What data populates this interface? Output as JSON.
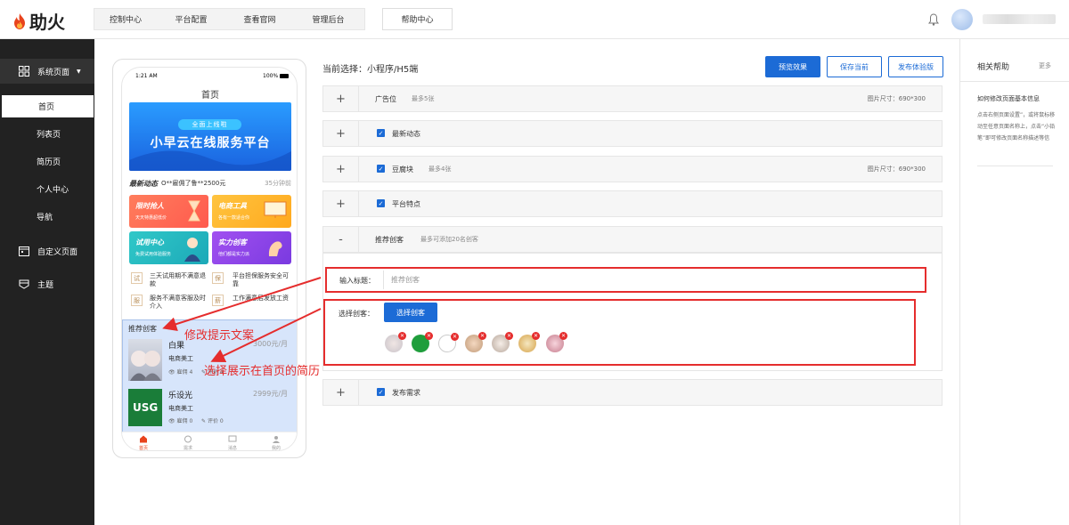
{
  "header": {
    "logo_text": "助火",
    "nav": [
      "控制中心",
      "平台配置",
      "查看官网",
      "管理后台"
    ],
    "help": "帮助中心"
  },
  "sidebar": {
    "system_pages": "系统页面",
    "sub_items": [
      "首页",
      "列表页",
      "简历页",
      "个人中心",
      "导航"
    ],
    "custom_pages": "自定义页面",
    "theme": "主题"
  },
  "phone": {
    "time": "1:21 AM",
    "battery": "100%",
    "title": "首页",
    "banner_pill": "全面上线啦",
    "banner_main": "小早云在线服务平台",
    "news_label": "最新动态",
    "news_text": "O**雇佣了鲁**2500元",
    "news_time": "35分钟前",
    "tiles": [
      {
        "title": "限时抢人",
        "sub": "天天特惠超低价"
      },
      {
        "title": "电商工具",
        "sub": "各有一款适合你"
      },
      {
        "title": "试用中心",
        "sub": "免费试用体验服务"
      },
      {
        "title": "实力创客",
        "sub": "他们都是实力派"
      }
    ],
    "features": [
      {
        "icon": "试",
        "text": "三天试用期不满意退款"
      },
      {
        "icon": "保",
        "text": "平台担保服务安全可靠"
      },
      {
        "icon": "服",
        "text": "服务不满意客服及时介入"
      },
      {
        "icon": "薪",
        "text": "工作满意后发放工资"
      }
    ],
    "rec_title": "推荐创客",
    "rec_items": [
      {
        "name": "白果",
        "price": "3000元/月",
        "role": "电商美工",
        "hire": "雇佣 4",
        "review": "评价 4"
      },
      {
        "name": "乐设光",
        "price": "2999元/月",
        "role": "电商美工",
        "hire": "雇佣 0",
        "review": "评价 0"
      }
    ],
    "tabs": [
      "首页",
      "需求",
      "消息",
      "我的"
    ]
  },
  "main": {
    "current_selection": "当前选择：小程序/H5端",
    "preview_btn": "预览效果",
    "save_btn": "保存当前",
    "publish_btn": "发布体验版",
    "panels": [
      {
        "title": "广告位",
        "hint": "最多5张",
        "size": "图片尺寸：690*300"
      },
      {
        "title": "最新动态",
        "hint": "",
        "size": ""
      },
      {
        "title": "豆腐块",
        "hint": "最多4张",
        "size": "图片尺寸：690*300"
      },
      {
        "title": "平台特点",
        "hint": "",
        "size": ""
      },
      {
        "title": "推荐创客",
        "hint": "最多可添加20名创客",
        "size": ""
      },
      {
        "title": "发布需求",
        "hint": "",
        "size": ""
      }
    ],
    "input_label": "输入标题：",
    "input_placeholder": "推荐创客",
    "select_label": "选择创客：",
    "select_btn": "选择创客",
    "annotation_1": "修改提示文案",
    "annotation_2": "选择展示在首页的简历"
  },
  "help_panel": {
    "title": "相关帮助",
    "more": "更多",
    "q_title": "如何修改页面基本信息",
    "q_body": "点击右侧页面设置”，或将鼠标移动至任意页面名称上，点击“小铅笔”即可修改页面名称描述等信"
  },
  "colors": {
    "primary": "#1c6bd6",
    "annotation": "#e52d2d",
    "sidebar": "#222222"
  }
}
